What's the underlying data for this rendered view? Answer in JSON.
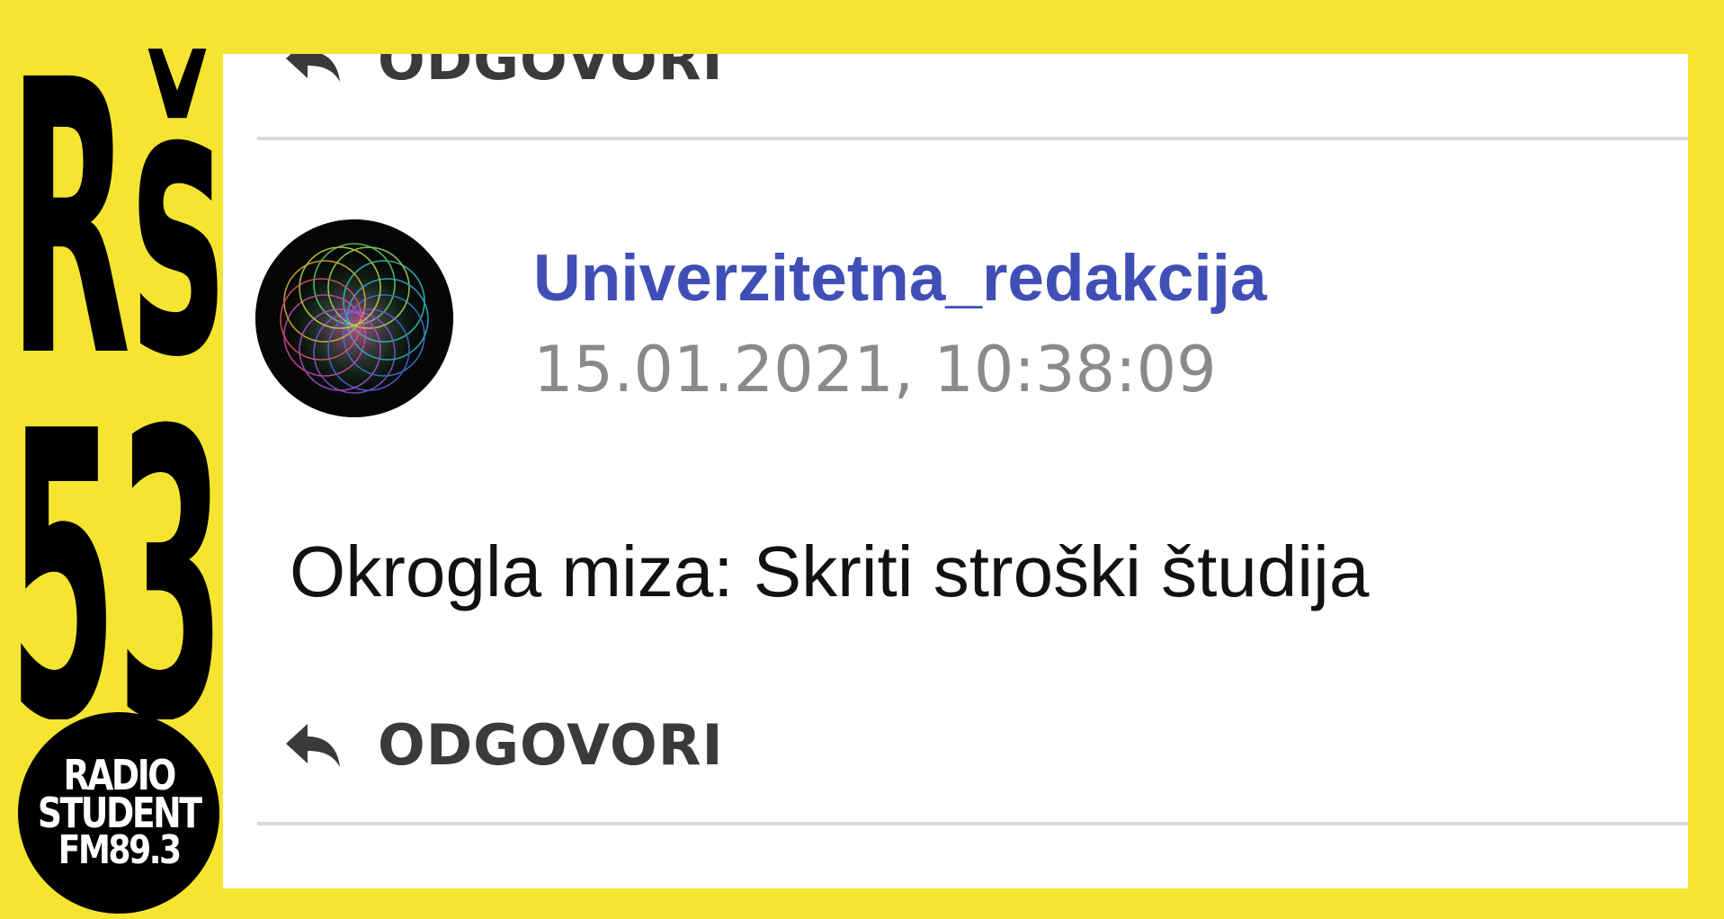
{
  "brand": {
    "top_letters": "Rš",
    "number": "53",
    "station": {
      "line1": "RADIO",
      "line2": "STUDENT",
      "line3": "FM89.3"
    }
  },
  "thread": {
    "reply_label_top": "ODGOVORI",
    "post": {
      "username": "Univerzitetna_redakcija",
      "timestamp": "15.01.2021, 10:38:09",
      "text": "Okrogla miza: Skriti stroški študija",
      "reply_label": "ODGOVORI"
    }
  },
  "icons": {
    "reply": "reply-arrow-icon",
    "avatar": "spirograph-avatar"
  },
  "colors": {
    "frame": "#f5e531",
    "username": "#3f4fb5",
    "timestamp": "#8a8a8a",
    "reply_label": "#3a3a3a"
  }
}
